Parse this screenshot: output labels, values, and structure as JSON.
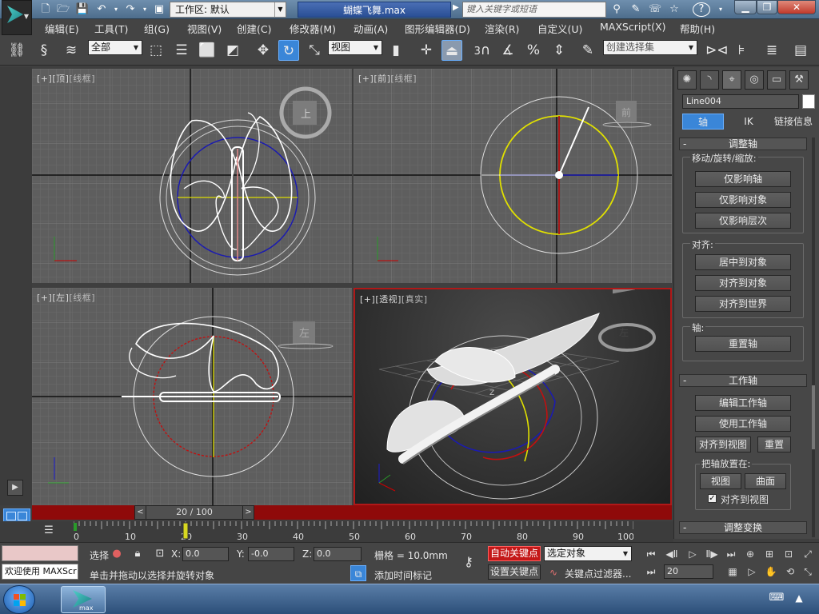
{
  "title_bar": {
    "workspace_label": "工作区: 默认",
    "document_title": "蝴蝶飞舞.max",
    "search_placeholder": "键入关键字或短语"
  },
  "menu": {
    "items": [
      "编辑(E)",
      "工具(T)",
      "组(G)",
      "视图(V)",
      "创建(C)",
      "修改器(M)",
      "动画(A)",
      "图形编辑器(D)",
      "渲染(R)",
      "自定义(U)",
      "MAXScript(X)",
      "帮助(H)"
    ]
  },
  "toolbar": {
    "selection_filter": "全部",
    "ref_coord": "视图",
    "snap_label": "3",
    "named_selection": "创建选择集"
  },
  "viewports": {
    "top": {
      "bracket": "[+]",
      "view": "[顶]",
      "shading": "[线框]",
      "cube_label": "上"
    },
    "front": {
      "bracket": "[+]",
      "view": "[前]",
      "shading": "[线框]",
      "cube_label": "前"
    },
    "left": {
      "bracket": "[+]",
      "view": "[左]",
      "shading": "[线框]",
      "cube_label": "左"
    },
    "persp": {
      "bracket": "[+]",
      "view": "[透视]",
      "shading": "[真实]",
      "cube_label": "左"
    }
  },
  "command_panel": {
    "object_name": "Line004",
    "subtabs": [
      "轴",
      "IK",
      "链接信息"
    ],
    "rollout_adjust_pivot": "调整轴",
    "group_move_rotate_scale": "移动/旋转/缩放:",
    "btn_affect_pivot": "仅影响轴",
    "btn_affect_object": "仅影响对象",
    "btn_affect_hierarchy": "仅影响层次",
    "group_align": "对齐:",
    "btn_center_to_object": "居中到对象",
    "btn_align_to_object": "对齐到对象",
    "btn_align_to_world": "对齐到世界",
    "group_pivot": "轴:",
    "btn_reset_pivot": "重置轴",
    "rollout_working_pivot": "工作轴",
    "btn_edit_working_pivot": "编辑工作轴",
    "btn_use_working_pivot": "使用工作轴",
    "btn_align_to_view": "对齐到视图",
    "btn_reset": "重置",
    "group_place_pivot": "把轴放置在:",
    "btn_view": "视图",
    "btn_surface": "曲面",
    "chk_align_to_view": "对齐到视图",
    "rollout_adjust_transform": "调整变换"
  },
  "timeline": {
    "frame_display": "20 / 100",
    "current_frame": 20,
    "total_frames": 100,
    "ticks": [
      "0",
      "10",
      "20",
      "30",
      "40",
      "50",
      "60",
      "70",
      "80",
      "90",
      "100"
    ]
  },
  "status": {
    "welcome": "欢迎使用 MAXScr",
    "selection_label": "选择",
    "prompt": "单击并拖动以选择并旋转对象",
    "x_label": "X:",
    "x_value": "0.0",
    "y_label": "Y:",
    "y_value": "-0.0",
    "z_label": "Z:",
    "z_value": "0.0",
    "grid": "栅格 = 10.0mm",
    "add_time_tag": "添加时间标记",
    "auto_key": "自动关键点",
    "set_key": "设置关键点",
    "key_mode": "选定对象",
    "key_filters": "关键点过滤器...",
    "frame_field": "20"
  },
  "colors": {
    "accent": "#3a86d8",
    "auto_key_red": "#c41818",
    "time_slider_red": "#8f0a0a",
    "active_viewport_border": "#b01818"
  }
}
